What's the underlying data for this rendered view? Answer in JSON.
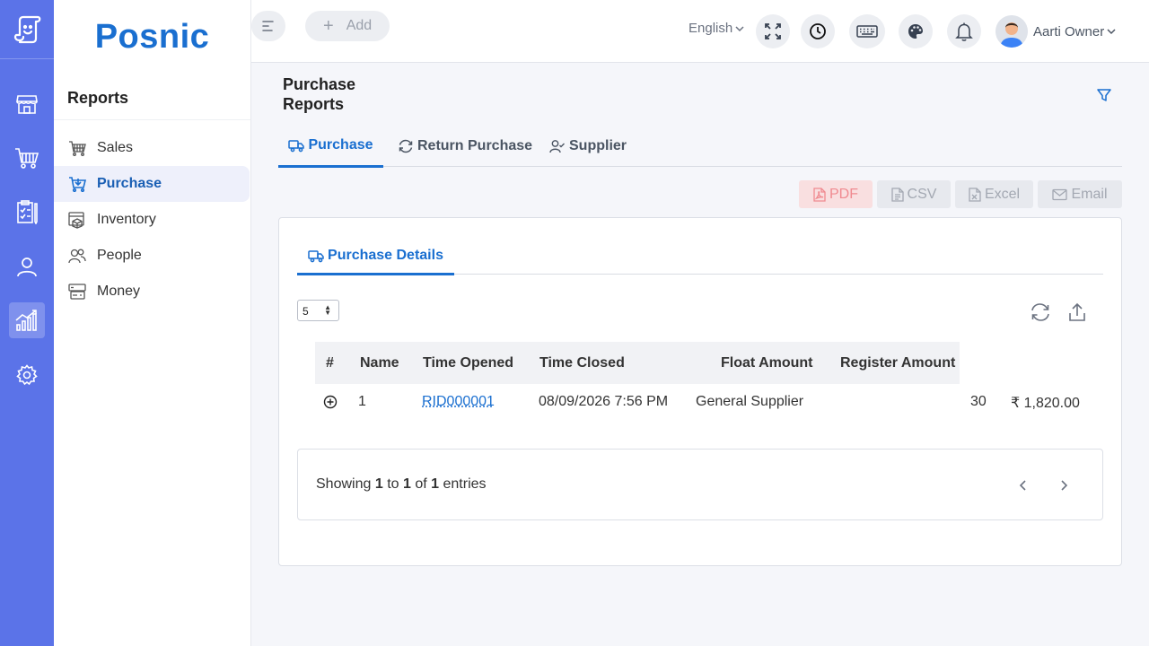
{
  "brand": {
    "name": "Posnic"
  },
  "sidebar": {
    "title": "Reports",
    "items": [
      {
        "label": "Sales",
        "icon": "basket-icon"
      },
      {
        "label": "Purchase",
        "icon": "cart-icon"
      },
      {
        "label": "Inventory",
        "icon": "inventory-icon"
      },
      {
        "label": "People",
        "icon": "people-icon"
      },
      {
        "label": "Money",
        "icon": "money-icon"
      }
    ]
  },
  "topbar": {
    "add_label": "Add",
    "language": "English",
    "user_name": "Aarti Owner"
  },
  "page": {
    "title": "Purchase Reports",
    "tabs": [
      {
        "label": "Purchase"
      },
      {
        "label": "Return Purchase"
      },
      {
        "label": "Supplier"
      }
    ]
  },
  "export": {
    "pdf": "PDF",
    "csv": "CSV",
    "excel": "Excel",
    "email": "Email"
  },
  "card": {
    "tab_label": "Purchase Details",
    "page_size": "5",
    "columns": [
      "#",
      "Name",
      "Time Opened",
      "Time Closed",
      "Float Amount",
      "Register Amount"
    ],
    "rows": [
      {
        "index": "1",
        "name": "RID000001",
        "time_opened": "08/09/2026 7:56 PM",
        "time_closed": "General Supplier",
        "float_amount": "30",
        "register_amount": "₹ 1,820.00"
      }
    ],
    "pagination": {
      "prefix": "Showing",
      "from": "1",
      "to_word": "to",
      "to": "1",
      "of_word": "of",
      "total": "1",
      "suffix": "entries"
    }
  },
  "colors": {
    "rail": "#5b73e8",
    "primary": "#1a6fd0",
    "pdf_bg": "#f9dfe0",
    "pdf_text": "#f08a90"
  }
}
